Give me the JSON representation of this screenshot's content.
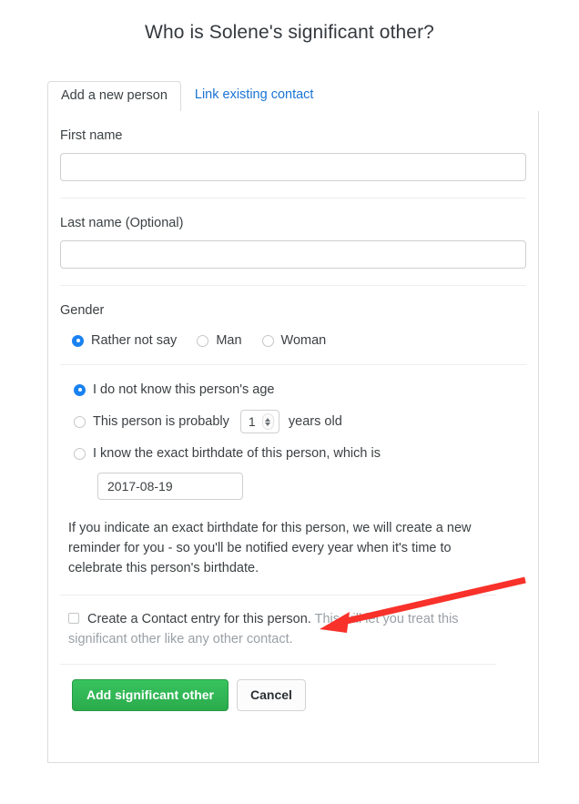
{
  "page": {
    "title": "Who is Solene's significant other?"
  },
  "tabs": [
    {
      "label": "Add a new person",
      "active": true
    },
    {
      "label": "Link existing contact",
      "active": false
    }
  ],
  "form": {
    "first_name": {
      "label": "First name",
      "value": "",
      "placeholder": ""
    },
    "last_name": {
      "label": "Last name (Optional)",
      "value": "",
      "placeholder": ""
    },
    "gender": {
      "label": "Gender",
      "options": [
        {
          "label": "Rather not say",
          "selected": true
        },
        {
          "label": "Man",
          "selected": false
        },
        {
          "label": "Woman",
          "selected": false
        }
      ]
    },
    "age": {
      "option_unknown": "I do not know this person's age",
      "option_probably_prefix": "This person is probably",
      "option_probably_suffix": "years old",
      "age_value": "1",
      "option_exact": "I know the exact birthdate of this person, which is",
      "birthdate_value": "2017-08-19",
      "selected": "unknown",
      "help_text": "If you indicate an exact birthdate for this person, we will create a new reminder for you - so you'll be notified every year when it's time to celebrate this person's birthdate."
    },
    "contact_entry": {
      "label": "Create a Contact entry for this person.",
      "hint": "This will let you treat this significant other like any other contact.",
      "checked": false
    }
  },
  "actions": {
    "submit_label": "Add significant other",
    "cancel_label": "Cancel"
  },
  "colors": {
    "accent_blue": "#1a82f0",
    "link_blue": "#1a73d4",
    "primary_green": "#2eb553",
    "annotation_red": "#f8312a",
    "muted_gray": "#9aa0a6"
  }
}
